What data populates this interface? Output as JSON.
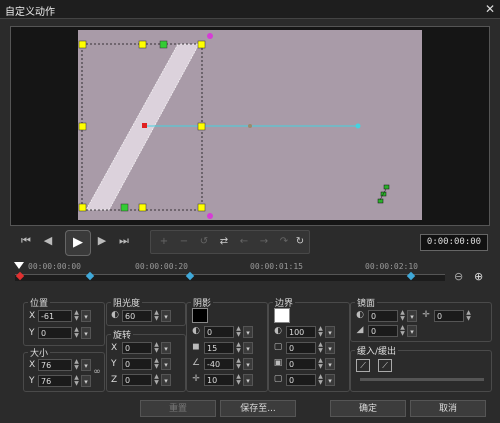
{
  "window": {
    "title": "自定义动作",
    "close_glyph": "✕"
  },
  "playback": {
    "timecode": "0:00:00:00"
  },
  "timeline": {
    "ticks": [
      "00:00:00:00",
      "00:00:00:20",
      "00:00:01:15",
      "00:00:02:10"
    ]
  },
  "position": {
    "label": "位置",
    "x_label": "X",
    "x": "-61",
    "y_label": "Y",
    "y": "0"
  },
  "size": {
    "label": "大小",
    "x_label": "X",
    "x": "76",
    "y_label": "Y",
    "y": "76"
  },
  "opacity": {
    "label": "阻光度",
    "value": "60"
  },
  "rotation": {
    "label": "旋转",
    "x_label": "X",
    "x": "0",
    "y_label": "Y",
    "y": "0",
    "z_label": "Z",
    "z": "0"
  },
  "shadow": {
    "label": "阴影",
    "opacity": "0",
    "blur": "15",
    "angle": "-40",
    "distance": "10",
    "color": "#000000"
  },
  "border": {
    "label": "边界",
    "opacity": "100",
    "width": "0",
    "softness": "0",
    "round": "0",
    "color": "#ffffff"
  },
  "mirror": {
    "label": "镜面",
    "opacity": "0",
    "gap": "0",
    "extra": "0"
  },
  "fade": {
    "label": "缓入/缓出"
  },
  "buttons": {
    "reset": "重置",
    "save_as": "保存至...",
    "ok": "确定",
    "cancel": "取消"
  }
}
